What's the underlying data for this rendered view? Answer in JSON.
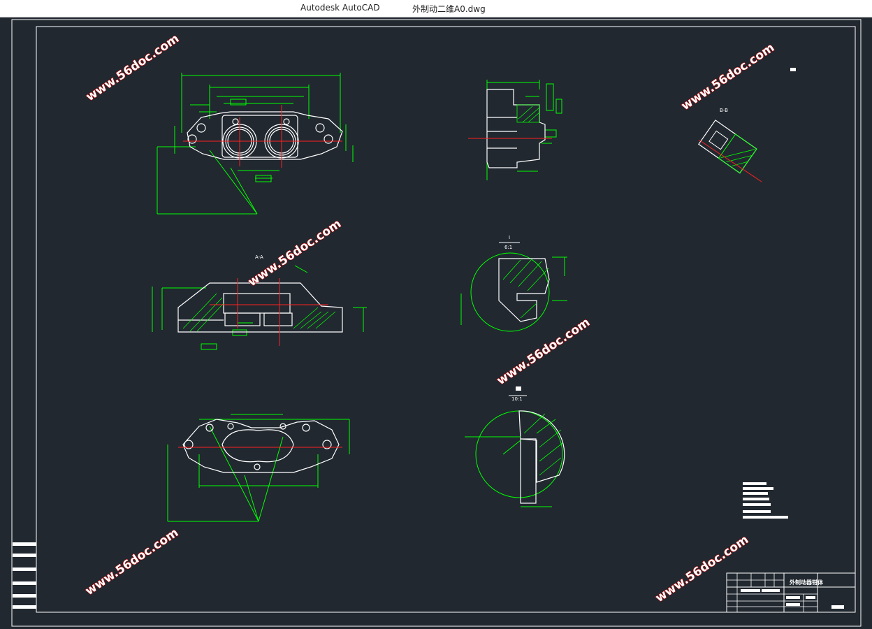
{
  "window": {
    "app_name": "Autodesk AutoCAD",
    "file_name": "外制动二维A0.dwg"
  },
  "watermarks": {
    "text": "www.56doc.com"
  },
  "views": {
    "section_a_label": "A-A",
    "section_b_label": "B-B",
    "detail_i_label": "I",
    "detail_i_scale": "6:1",
    "detail_ii_scale": "10:1"
  },
  "title_block": {
    "drawing_name": "外制动器钳体"
  },
  "colors": {
    "background": "#212830",
    "geometry": "#ffffff",
    "dimension": "#00ff00",
    "centerline": "#ff2020",
    "watermark_stroke": "#b00000"
  }
}
